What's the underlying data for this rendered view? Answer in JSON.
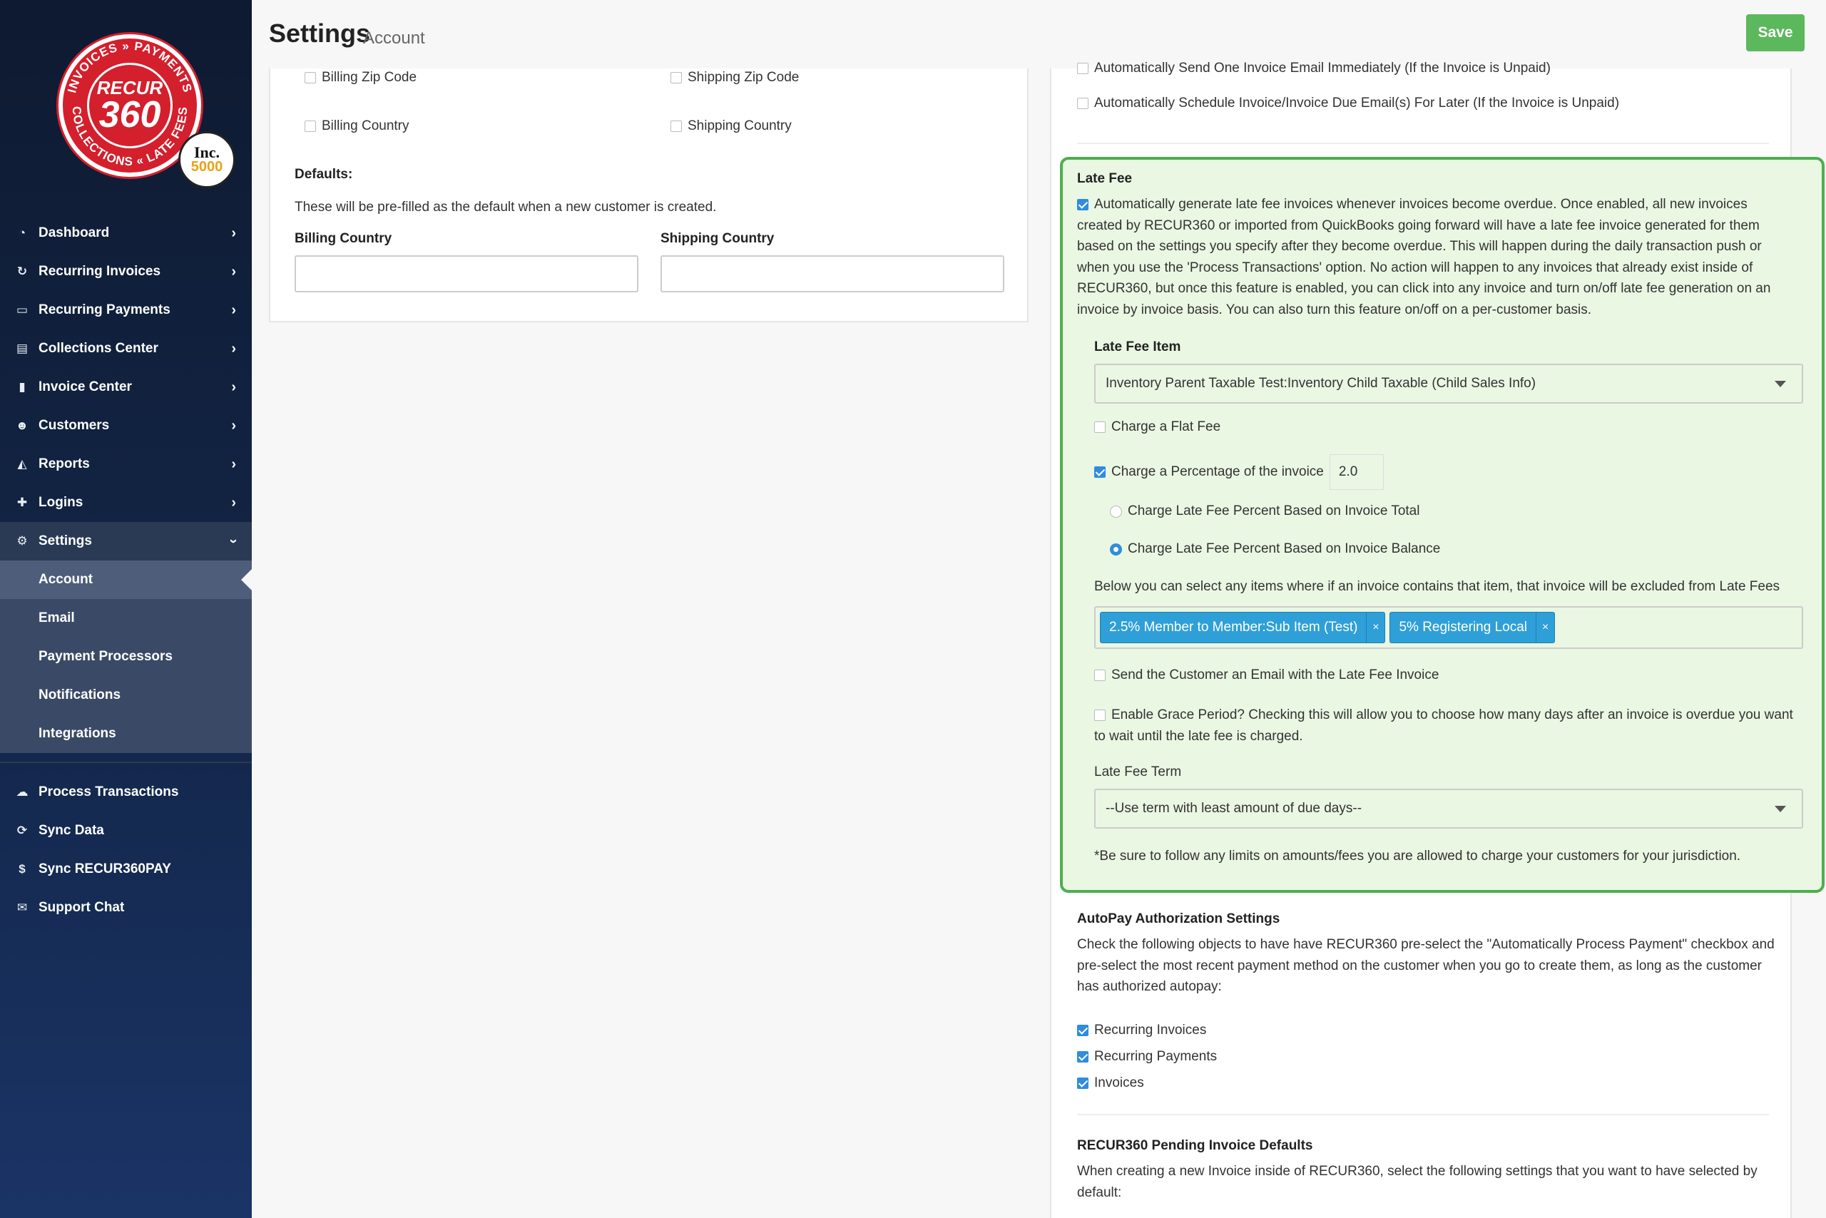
{
  "logo": {
    "ring_top": "INVOICES » PAYMENTS",
    "ring_bottom": "COLLECTIONS « LATE FEES",
    "recur": "RECUR",
    "num": "360",
    "inc": "Inc.",
    "inc_num": "5000"
  },
  "sidebar": {
    "items": [
      {
        "label": "Dashboard",
        "icon": "tachometer-icon",
        "glyph": "◔"
      },
      {
        "label": "Recurring Invoices",
        "icon": "refresh-icon",
        "glyph": "↻"
      },
      {
        "label": "Recurring Payments",
        "icon": "credit-card-icon",
        "glyph": "▭"
      },
      {
        "label": "Collections Center",
        "icon": "file-icon",
        "glyph": "▤"
      },
      {
        "label": "Invoice Center",
        "icon": "document-icon",
        "glyph": "▮"
      },
      {
        "label": "Customers",
        "icon": "users-icon",
        "glyph": "☻"
      },
      {
        "label": "Reports",
        "icon": "area-chart-icon",
        "glyph": "◭"
      },
      {
        "label": "Logins",
        "icon": "user-plus-icon",
        "glyph": "✚"
      }
    ],
    "settings": {
      "label": "Settings",
      "glyph": "⚙"
    },
    "submenu": [
      "Account",
      "Email",
      "Payment Processors",
      "Notifications",
      "Integrations"
    ],
    "bottom": [
      {
        "label": "Process Transactions",
        "icon": "cloud-upload-icon",
        "glyph": "☁"
      },
      {
        "label": "Sync Data",
        "icon": "sync-icon",
        "glyph": "⟳"
      },
      {
        "label": "Sync RECUR360PAY",
        "icon": "dollar-icon",
        "glyph": "$"
      },
      {
        "label": "Support Chat",
        "icon": "chat-icon",
        "glyph": "✉"
      }
    ]
  },
  "header": {
    "title": "Settings",
    "subtitle": "Account",
    "save": "Save"
  },
  "left": {
    "billing_zip": "Billing Zip Code",
    "shipping_zip": "Shipping Zip Code",
    "billing_country_cb": "Billing Country",
    "shipping_country_cb": "Shipping Country",
    "defaults_heading": "Defaults:",
    "defaults_desc": "These will be pre-filled as the default when a new customer is created.",
    "billing_country_label": "Billing Country",
    "shipping_country_label": "Shipping Country",
    "billing_country_value": "",
    "shipping_country_value": ""
  },
  "right": {
    "auto_send_partial": "Automatically Send One Invoice Email Immediately (If the Invoice is Unpaid)",
    "auto_schedule": "Automatically Schedule Invoice/Invoice Due Email(s) For Later (If the Invoice is Unpaid)",
    "late_fee": {
      "title": "Late Fee",
      "desc": "Automatically generate late fee invoices whenever invoices become overdue. Once enabled, all new invoices created by RECUR360 or imported from QuickBooks going forward will have a late fee invoice generated for them based on the settings you specify after they become overdue. This will happen during the daily transaction push or when you use the 'Process Transactions' option. No action will happen to any invoices that already exist inside of RECUR360, but once this feature is enabled, you can click into any invoice and turn on/off late fee generation on an invoice by invoice basis. You can also turn this feature on/off on a per-customer basis.",
      "item_label": "Late Fee Item",
      "item_value": "Inventory Parent Taxable Test:Inventory Child Taxable (Child Sales Info)",
      "flat_fee": "Charge a Flat Fee",
      "percentage": "Charge a Percentage of the invoice",
      "percentage_value": "2.0",
      "radio_total": "Charge Late Fee Percent Based on Invoice Total",
      "radio_balance": "Charge Late Fee Percent Based on Invoice Balance",
      "exclude_desc": "Below you can select any items where if an invoice contains that item, that invoice will be excluded from Late Fees",
      "tags": [
        "2.5% Member to Member:Sub Item (Test)",
        "5% Registering Local"
      ],
      "tag_remove": "×",
      "send_email": "Send the Customer an Email with the Late Fee Invoice",
      "grace": "Enable Grace Period? Checking this will allow you to choose how many days after an invoice is overdue you want to wait until the late fee is charged.",
      "term_label": "Late Fee Term",
      "term_value": "--Use term with least amount of due days--",
      "disclaimer": "*Be sure to follow any limits on amounts/fees you are allowed to charge your customers for your jurisdiction."
    },
    "autopay": {
      "heading": "AutoPay Authorization Settings",
      "desc": "Check the following objects to have have RECUR360 pre-select the \"Automatically Process Payment\" checkbox and pre-select the most recent payment method on the customer when you go to create them, as long as the customer has authorized autopay:",
      "items": [
        "Recurring Invoices",
        "Recurring Payments",
        "Invoices"
      ]
    },
    "pending": {
      "heading": "RECUR360 Pending Invoice Defaults",
      "desc": "When creating a new Invoice inside of RECUR360, select the following settings that you want to have selected by default:"
    }
  }
}
